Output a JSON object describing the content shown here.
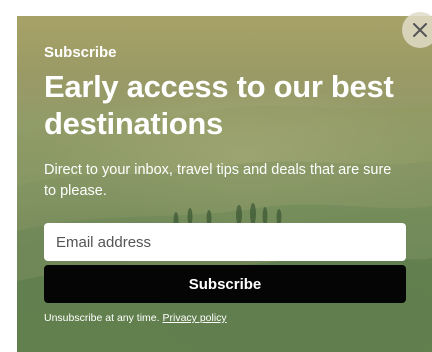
{
  "modal": {
    "eyebrow": "Subscribe",
    "headline": "Early access to our best destinations",
    "description": "Direct to your inbox, travel tips and deals that are sure to please.",
    "email_placeholder": "Email address",
    "email_value": "",
    "subscribe_label": "Subscribe",
    "fine_print": "Unsubscribe at any time.",
    "privacy_link": "Privacy policy",
    "close_icon": "close-icon"
  },
  "colors": {
    "text": "#ffffff",
    "button_bg": "#050505",
    "input_bg": "#ffffff",
    "backdrop_green": "#7f9768"
  }
}
